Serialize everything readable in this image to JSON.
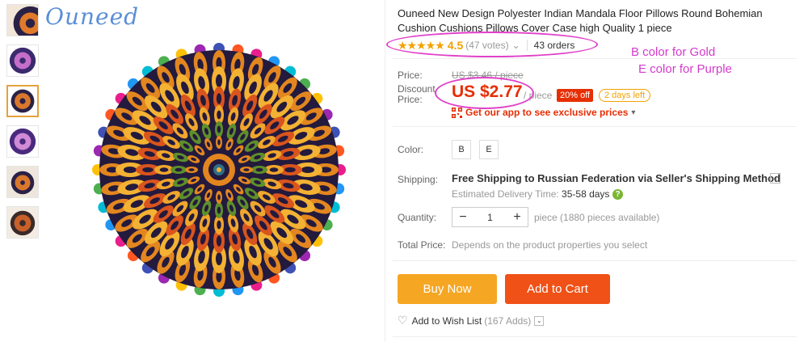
{
  "brand": {
    "logo_text": "Ouneed"
  },
  "thumbnails": [
    {
      "label": "Mandala pillow view 1"
    },
    {
      "label": "Mandala pillow view 2"
    },
    {
      "label": "Mandala pillow view 3 (selected)"
    },
    {
      "label": "Mandala pillow view 4"
    },
    {
      "label": "Mandala pillow view 5"
    },
    {
      "label": "Mandala pillow view 6"
    }
  ],
  "product": {
    "title": "Ouneed New Design Polyester Indian Mandala Floor Pillows Round Bohemian Cushion Cushions Pillows Cover Case high Quality 1 piece",
    "stars": "★★★★★",
    "rating": "4.5",
    "votes": "(47 votes)",
    "votes_caret": "⌄",
    "orders": "43 orders"
  },
  "annotations": {
    "line1": "B color for Gold",
    "line2": "E color for Purple"
  },
  "pricing": {
    "price_label": "Price:",
    "old_price": "US $3.46 / piece",
    "discount_label_1": "Discount",
    "discount_label_2": "Price:",
    "new_price": "US $2.77",
    "per_piece": "/ piece",
    "off_badge": "20% off",
    "days_left": "2 days left",
    "app_promo": "Get our app to see exclusive prices",
    "app_caret": "▾"
  },
  "options": {
    "color_label": "Color:",
    "colors": [
      "B",
      "E"
    ],
    "shipping_label": "Shipping:",
    "shipping_text": "Free Shipping to Russian Federation via Seller's Shipping Method",
    "shipping_caret": "⌄",
    "est_label": "Estimated Delivery Time:",
    "est_value": "35-58 days",
    "help": "?",
    "quantity_label": "Quantity:",
    "qty_minus": "−",
    "qty_value": "1",
    "qty_plus": "+",
    "qty_available": "piece (1880 pieces available)",
    "total_label": "Total Price:",
    "total_note": "Depends on the product properties you select"
  },
  "actions": {
    "buy_now": "Buy Now",
    "add_to_cart": "Add to Cart",
    "wish_icon": "♡",
    "wish_label": "Add to Wish List",
    "wish_count": "(167 Adds)",
    "wish_caret": "⌄"
  },
  "colors": {
    "accent_red": "#e62e04",
    "star": "#f4a100",
    "annotation": "#d43acd",
    "buy_now": "#f5a623",
    "add_to_cart": "#f05117"
  }
}
